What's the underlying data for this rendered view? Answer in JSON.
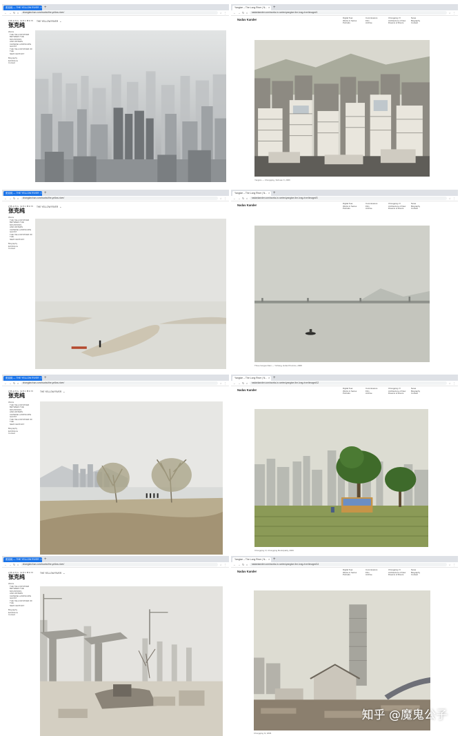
{
  "left_site": {
    "logo_roman": "ZHANG KECHUN",
    "logo_cn": "张克纯",
    "nav": [
      {
        "label": "Works",
        "cls": ""
      },
      {
        "label": "THE YELLOW RIVER",
        "cls": "sub"
      },
      {
        "label": "BETWEEN THE MOUNTAINS",
        "cls": "sub"
      },
      {
        "label": "AND WATERS",
        "cls": "sub"
      },
      {
        "label": "CHINESE LANDSCAPE",
        "cls": "sub"
      },
      {
        "label": "GHOST",
        "cls": "sub"
      },
      {
        "label": "THE YELLOW RIVER OF THE",
        "cls": "sub"
      },
      {
        "label": "NEW CENTURY",
        "cls": "sub"
      },
      {
        "label": "",
        "cls": "gap"
      },
      {
        "label": "Biography",
        "cls": ""
      },
      {
        "label": "Exhibitions",
        "cls": ""
      },
      {
        "label": "Contact",
        "cls": ""
      }
    ],
    "project_title": "THE YELLOW RIVER"
  },
  "right_site": {
    "name": "Nadav Kander",
    "nav": {
      "col1": [
        "Digital Tear",
        "Works in Series",
        "Portraits"
      ],
      "col2": [
        "Commissions",
        "Film",
        "Archive"
      ],
      "col3": [
        "Chongqing VI",
        "Architecture of Now",
        "Dreams of Rivers"
      ],
      "col4": [
        "News",
        "Biography",
        "Contact"
      ]
    }
  },
  "panels": [
    {
      "left": {
        "tab": "张克纯 — THE YELLOW RIVER",
        "url": "zhangkechun.com/works/the-yellow-river/"
      },
      "right": {
        "tab": "Yangtze – The Long River | N...",
        "url": "nadavkander.com/works-in-series/yangtze-the-long-river/image#1",
        "caption": "Yangtze — Chongqing, Sichuan X, 2006"
      }
    },
    {
      "left": {
        "tab": "张克纯 — THE YELLOW RIVER",
        "url": "zhangkechun.com/works/the-yellow-river/"
      },
      "right": {
        "tab": "Yangtze – The Long River | N...",
        "url": "nadavkander.com/works-in-series/yangtze-the-long-river/image#3",
        "caption": "Three Gorges Dam — Yichang, Hubei Province, 2008"
      }
    },
    {
      "left": {
        "tab": "张克纯 — THE YELLOW RIVER",
        "url": "zhangkechun.com/works/the-yellow-river/"
      },
      "right": {
        "tab": "Yangtze – The Long River | N...",
        "url": "nadavkander.com/works-in-series/yangtze-the-long-river/image#12",
        "caption": "Chongqing VI, Chongqing Municipality, 2006"
      }
    },
    {
      "left": {
        "tab": "张克纯 — THE YELLOW RIVER",
        "url": "zhangkechun.com/works/the-yellow-river/"
      },
      "right": {
        "tab": "Yangtze – The Long River | N...",
        "url": "nadavkander.com/works-in-series/yangtze-the-long-river/image#14",
        "caption": "Chongqing IV, 2006"
      }
    }
  ],
  "watermark": "知乎 @魔鬼公子",
  "icons": {
    "nav_back": "←",
    "nav_forward": "→",
    "reload": "↻",
    "home": "⌂",
    "tab_close": "×",
    "new_tab": "+",
    "dropdown": "⌄"
  },
  "colors": {
    "tab_active": "#1a73e8",
    "chrome_bar": "#dee1e6"
  }
}
